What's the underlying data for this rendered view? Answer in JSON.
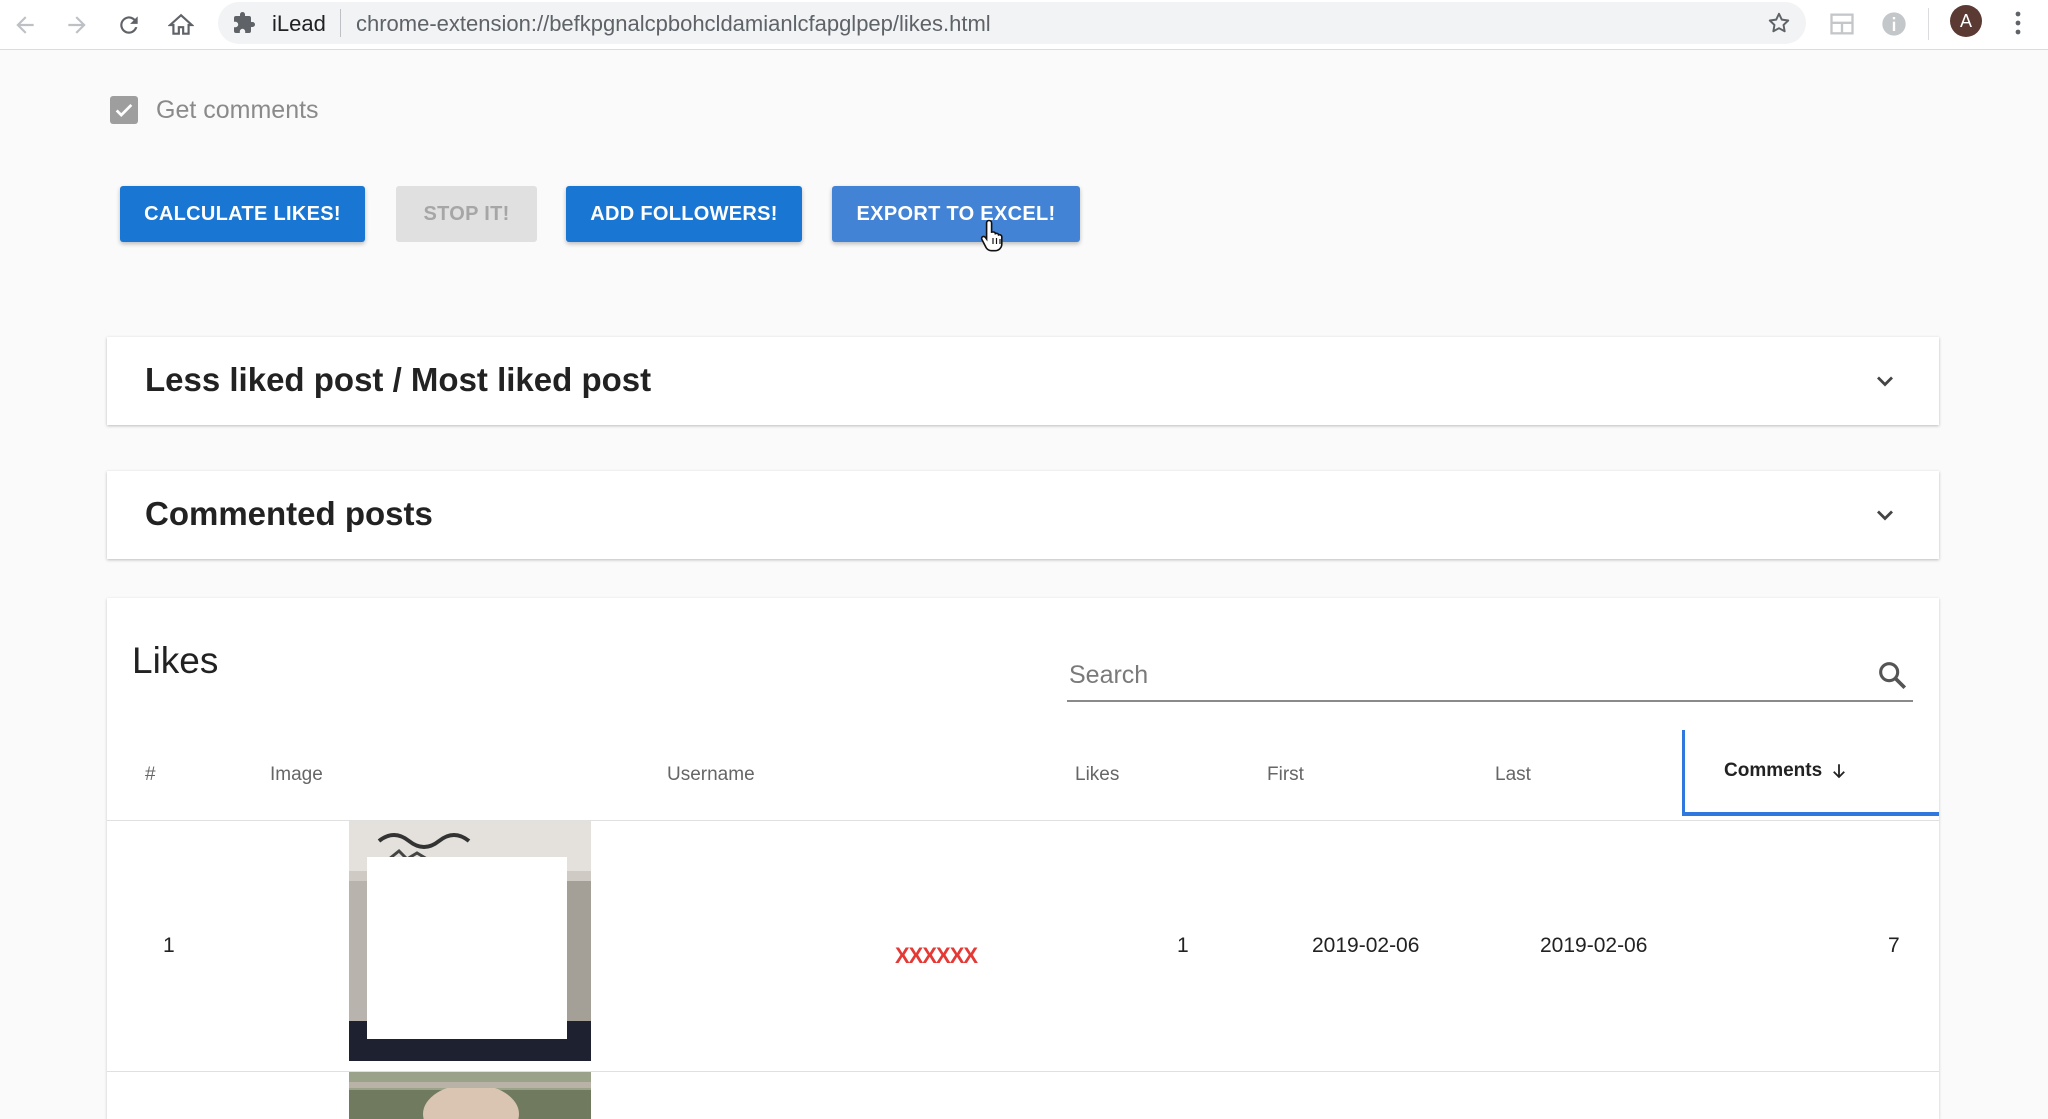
{
  "browser": {
    "extension_name": "iLead",
    "url": "chrome-extension://befkpgnalcpbohcldamianlcfapglpep/likes.html",
    "avatar_letter": "A"
  },
  "options": {
    "get_comments_label": "Get comments",
    "get_comments_checked": true
  },
  "buttons": {
    "calculate": "CALCULATE LIKES!",
    "stop": "STOP IT!",
    "add_followers": "ADD FOLLOWERS!",
    "export": "EXPORT TO EXCEL!"
  },
  "panels": {
    "liked_posts": "Less liked post / Most liked post",
    "commented_posts": "Commented posts"
  },
  "likes_table": {
    "title": "Likes",
    "search_placeholder": "Search",
    "columns": [
      "#",
      "Image",
      "Username",
      "Likes",
      "First",
      "Last",
      "Comments"
    ],
    "sorted_column": "Comments",
    "rows": [
      {
        "index": "1",
        "username": "XXXXXX",
        "likes": "1",
        "first": "2019-02-06",
        "last": "2019-02-06",
        "comments": "7"
      }
    ]
  },
  "colors": {
    "primary": "#1976d2",
    "primary_hover": "#4283d6",
    "disabled": "#e0e0e0",
    "sort_highlight": "#2f78de",
    "redacted": "#e53935"
  }
}
